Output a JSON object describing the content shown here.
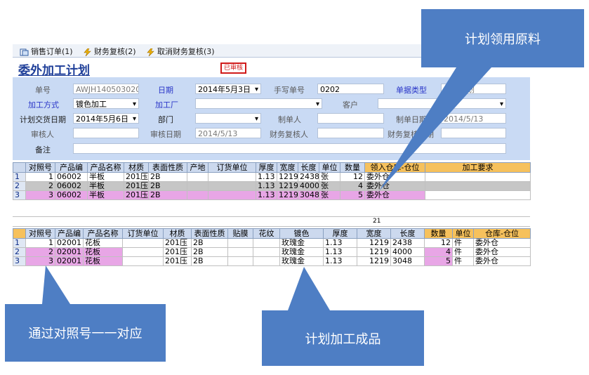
{
  "toolbar": {
    "items": [
      {
        "label": "销售订单(1)",
        "icon": "document-icon"
      },
      {
        "label": "财务复核(2)",
        "icon": "lightning-icon"
      },
      {
        "label": "取消财务复核(3)",
        "icon": "lightning-icon"
      }
    ]
  },
  "header": {
    "title": "委外加工计划",
    "status": "已审核"
  },
  "form": {
    "order_no_label": "单号",
    "order_no": "AWJH140503020",
    "date_label": "日期",
    "date": "2014年5月3日",
    "manual_no_label": "手写单号",
    "manual_no": "0202",
    "doc_type_label": "单据类型",
    "doc_type": "加工计划",
    "process_label": "加工方式",
    "process": "镀色加工",
    "factory_label": "加工厂",
    "factory": "",
    "customer_label": "客户",
    "customer": "",
    "plan_date_label": "计划交货日期",
    "plan_date": "2014年5月6日",
    "dept_label": "部门",
    "dept": "",
    "maker_label": "制单人",
    "maker": "",
    "make_date_label": "制单日期",
    "make_date": "2014/5/13",
    "auditor_label": "审核人",
    "auditor": "",
    "audit_date_label": "审核日期",
    "audit_date": "2014/5/13",
    "fin_reviewer_label": "财务复核人",
    "fin_reviewer": "",
    "fin_date_label": "财务复核日期",
    "fin_date": "",
    "remark_label": "备注",
    "remark": ""
  },
  "table1": {
    "headers": [
      "对照号",
      "产品编",
      "产品名称",
      "材质",
      "表面性质",
      "产地",
      "订货单位",
      "厚度",
      "宽度",
      "长度",
      "单位",
      "数量",
      "领入仓库-仓位",
      "加工要求"
    ],
    "rows": [
      {
        "rn": "1",
        "ref": "1",
        "code": "06002",
        "name": "半板",
        "mat": "201压",
        "surf": "2B",
        "origin": "",
        "unit_co": "",
        "thick": "1.13",
        "width": "1219",
        "length": "2438",
        "unit": "张",
        "qty": "12",
        "wh": "委外仓",
        "req": ""
      },
      {
        "rn": "2",
        "ref": "2",
        "code": "06002",
        "name": "半板",
        "mat": "201压",
        "surf": "2B",
        "origin": "",
        "unit_co": "",
        "thick": "1.13",
        "width": "1219",
        "length": "4000",
        "unit": "张",
        "qty": "4",
        "wh": "委外仓",
        "req": ""
      },
      {
        "rn": "3",
        "ref": "3",
        "code": "06002",
        "name": "半板",
        "mat": "201压",
        "surf": "2B",
        "origin": "",
        "unit_co": "",
        "thick": "1.13",
        "width": "1219",
        "length": "3048",
        "unit": "张",
        "qty": "5",
        "wh": "委外仓",
        "req": ""
      }
    ]
  },
  "summary": {
    "total": "21"
  },
  "table2": {
    "headers": [
      "对照号",
      "产品编",
      "产品名称",
      "订货单位",
      "材质",
      "表面性质",
      "贴膜",
      "花纹",
      "镀色",
      "厚度",
      "宽度",
      "长度",
      "数量",
      "单位",
      "仓库-仓位"
    ],
    "rows": [
      {
        "rn": "1",
        "ref": "1",
        "code": "02001",
        "name": "花板",
        "unit_co": "",
        "mat": "201压",
        "surf": "2B",
        "film": "",
        "pattern": "",
        "color": "玫瑰金",
        "thick": "1.13",
        "width": "1219",
        "length": "2438",
        "qty": "12",
        "unit": "件",
        "wh": "委外仓"
      },
      {
        "rn": "2",
        "ref": "2",
        "code": "02001",
        "name": "花板",
        "unit_co": "",
        "mat": "201压",
        "surf": "2B",
        "film": "",
        "pattern": "",
        "color": "玫瑰金",
        "thick": "1.13",
        "width": "1219",
        "length": "4000",
        "qty": "4",
        "unit": "件",
        "wh": "委外仓"
      },
      {
        "rn": "3",
        "ref": "3",
        "code": "02001",
        "name": "花板",
        "unit_co": "",
        "mat": "201压",
        "surf": "2B",
        "film": "",
        "pattern": "",
        "color": "玫瑰金",
        "thick": "1.13",
        "width": "1219",
        "length": "3048",
        "qty": "5",
        "unit": "件",
        "wh": "委外仓"
      }
    ]
  },
  "callouts": {
    "raw": "计划领用原料",
    "match": "通过对照号一一对应",
    "finished": "计划加工成品"
  },
  "colors": {
    "callout": "#4e7ec4",
    "form_bg": "#c9daf4",
    "pink": "#e8a6e6",
    "orange": "#f6c15c",
    "title": "#1f3f99"
  }
}
